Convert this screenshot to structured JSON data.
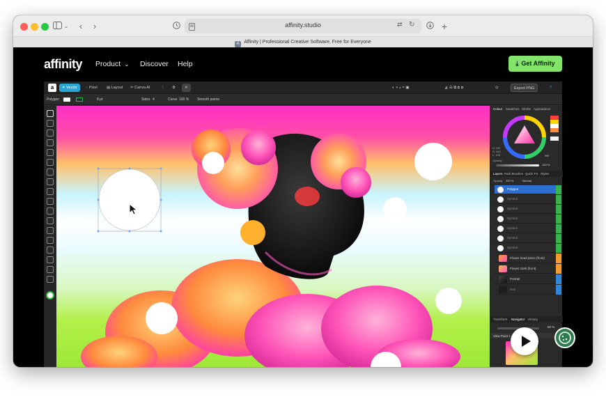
{
  "browser": {
    "url": "affinity.studio",
    "tab_title": "Affinity | Professional Creative Software, Free for Everyone",
    "tab_favicon": "A"
  },
  "site": {
    "logo": "affinity",
    "nav": [
      {
        "label": "Product",
        "has_dropdown": true
      },
      {
        "label": "Discover"
      },
      {
        "label": "Help"
      }
    ],
    "cta_label": "Get Affinity",
    "accent_color": "#83e46b"
  },
  "app": {
    "modes": [
      "Vector",
      "Pixel",
      "Layout",
      "Canva AI"
    ],
    "active_mode": "Vector",
    "export_label": "Export PNG",
    "context": {
      "tool": "Polygon",
      "stroke": "8 pt",
      "sides_label": "Sides",
      "sides": "4",
      "curve_label": "Curve",
      "curve": "100 %",
      "smooth_label": "Smooth points"
    },
    "panel_tabs": [
      "Colour",
      "Swatches",
      "Stroke",
      "Appearance"
    ],
    "color_readout": {
      "h": "H: 331",
      "s": "S: 100",
      "l": "L: 100",
      "hex": "ffffff",
      "opacity_label": "Opacity",
      "opacity": "100 %"
    },
    "layers_tabs": [
      "Layers",
      "Path Brushes",
      "Quick FX",
      "Styles"
    ],
    "layers_opacity": "100 %",
    "layers_blend": "Normal",
    "layers": [
      {
        "name": "Polygon",
        "selected": true
      },
      {
        "name": "Symbol"
      },
      {
        "name": "Symbol"
      },
      {
        "name": "Symbol"
      },
      {
        "name": "Symbol"
      },
      {
        "name": "Symbol"
      },
      {
        "name": "Symbol"
      }
    ],
    "groups": [
      {
        "name": "Flower head piece (front)",
        "stripe": "#f29a2e"
      },
      {
        "name": "Flower cloth (front)",
        "stripe": "#f29a2e"
      },
      {
        "name": "Portrait",
        "stripe": "#2f86d9"
      },
      {
        "name": "Hair",
        "stripe": "#2f86d9"
      }
    ],
    "bottom_tabs": [
      "Transform",
      "Navigator",
      "History"
    ],
    "zoom": "50 %",
    "view_point": "View Point 1"
  },
  "icons": [
    "sidebar-icon",
    "back-icon",
    "forward-icon",
    "history-icon",
    "reader-icon",
    "translate-icon",
    "reload-icon",
    "download-icon",
    "new-tab-icon",
    "chevron-down-icon",
    "download-arrow-icon",
    "play-icon",
    "cookie-icon",
    "cursor-icon"
  ]
}
